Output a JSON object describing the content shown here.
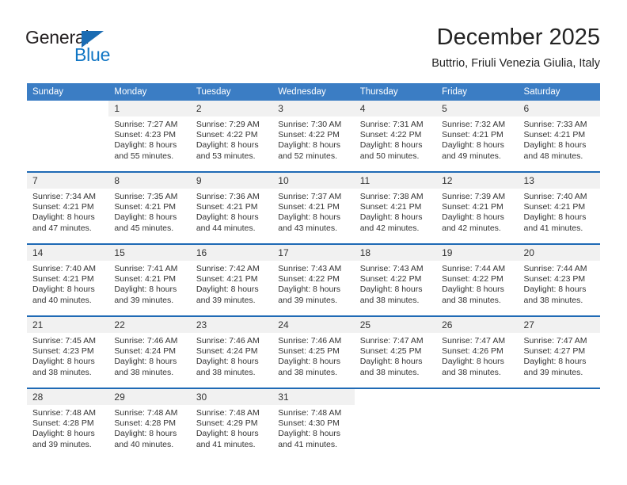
{
  "logo": {
    "word_top": "General",
    "word_bottom": "Blue",
    "triangle_color": "#1b6cb3",
    "blue_color": "#1176c4"
  },
  "header": {
    "title": "December 2025",
    "subtitle": "Buttrio, Friuli Venezia Giulia, Italy"
  },
  "theme": {
    "header_blue": "#3b7dc4",
    "separator_blue": "#1f6ab5",
    "daynum_band": "#f1f1f1",
    "text": "#333333"
  },
  "weekday_headers": [
    "Sunday",
    "Monday",
    "Tuesday",
    "Wednesday",
    "Thursday",
    "Friday",
    "Saturday"
  ],
  "weeks": [
    {
      "days": [
        {
          "num": "",
          "lines": []
        },
        {
          "num": "1",
          "lines": [
            "Sunrise: 7:27 AM",
            "Sunset: 4:23 PM",
            "Daylight: 8 hours",
            "and 55 minutes."
          ]
        },
        {
          "num": "2",
          "lines": [
            "Sunrise: 7:29 AM",
            "Sunset: 4:22 PM",
            "Daylight: 8 hours",
            "and 53 minutes."
          ]
        },
        {
          "num": "3",
          "lines": [
            "Sunrise: 7:30 AM",
            "Sunset: 4:22 PM",
            "Daylight: 8 hours",
            "and 52 minutes."
          ]
        },
        {
          "num": "4",
          "lines": [
            "Sunrise: 7:31 AM",
            "Sunset: 4:22 PM",
            "Daylight: 8 hours",
            "and 50 minutes."
          ]
        },
        {
          "num": "5",
          "lines": [
            "Sunrise: 7:32 AM",
            "Sunset: 4:21 PM",
            "Daylight: 8 hours",
            "and 49 minutes."
          ]
        },
        {
          "num": "6",
          "lines": [
            "Sunrise: 7:33 AM",
            "Sunset: 4:21 PM",
            "Daylight: 8 hours",
            "and 48 minutes."
          ]
        }
      ]
    },
    {
      "days": [
        {
          "num": "7",
          "lines": [
            "Sunrise: 7:34 AM",
            "Sunset: 4:21 PM",
            "Daylight: 8 hours",
            "and 47 minutes."
          ]
        },
        {
          "num": "8",
          "lines": [
            "Sunrise: 7:35 AM",
            "Sunset: 4:21 PM",
            "Daylight: 8 hours",
            "and 45 minutes."
          ]
        },
        {
          "num": "9",
          "lines": [
            "Sunrise: 7:36 AM",
            "Sunset: 4:21 PM",
            "Daylight: 8 hours",
            "and 44 minutes."
          ]
        },
        {
          "num": "10",
          "lines": [
            "Sunrise: 7:37 AM",
            "Sunset: 4:21 PM",
            "Daylight: 8 hours",
            "and 43 minutes."
          ]
        },
        {
          "num": "11",
          "lines": [
            "Sunrise: 7:38 AM",
            "Sunset: 4:21 PM",
            "Daylight: 8 hours",
            "and 42 minutes."
          ]
        },
        {
          "num": "12",
          "lines": [
            "Sunrise: 7:39 AM",
            "Sunset: 4:21 PM",
            "Daylight: 8 hours",
            "and 42 minutes."
          ]
        },
        {
          "num": "13",
          "lines": [
            "Sunrise: 7:40 AM",
            "Sunset: 4:21 PM",
            "Daylight: 8 hours",
            "and 41 minutes."
          ]
        }
      ]
    },
    {
      "days": [
        {
          "num": "14",
          "lines": [
            "Sunrise: 7:40 AM",
            "Sunset: 4:21 PM",
            "Daylight: 8 hours",
            "and 40 minutes."
          ]
        },
        {
          "num": "15",
          "lines": [
            "Sunrise: 7:41 AM",
            "Sunset: 4:21 PM",
            "Daylight: 8 hours",
            "and 39 minutes."
          ]
        },
        {
          "num": "16",
          "lines": [
            "Sunrise: 7:42 AM",
            "Sunset: 4:21 PM",
            "Daylight: 8 hours",
            "and 39 minutes."
          ]
        },
        {
          "num": "17",
          "lines": [
            "Sunrise: 7:43 AM",
            "Sunset: 4:22 PM",
            "Daylight: 8 hours",
            "and 39 minutes."
          ]
        },
        {
          "num": "18",
          "lines": [
            "Sunrise: 7:43 AM",
            "Sunset: 4:22 PM",
            "Daylight: 8 hours",
            "and 38 minutes."
          ]
        },
        {
          "num": "19",
          "lines": [
            "Sunrise: 7:44 AM",
            "Sunset: 4:22 PM",
            "Daylight: 8 hours",
            "and 38 minutes."
          ]
        },
        {
          "num": "20",
          "lines": [
            "Sunrise: 7:44 AM",
            "Sunset: 4:23 PM",
            "Daylight: 8 hours",
            "and 38 minutes."
          ]
        }
      ]
    },
    {
      "days": [
        {
          "num": "21",
          "lines": [
            "Sunrise: 7:45 AM",
            "Sunset: 4:23 PM",
            "Daylight: 8 hours",
            "and 38 minutes."
          ]
        },
        {
          "num": "22",
          "lines": [
            "Sunrise: 7:46 AM",
            "Sunset: 4:24 PM",
            "Daylight: 8 hours",
            "and 38 minutes."
          ]
        },
        {
          "num": "23",
          "lines": [
            "Sunrise: 7:46 AM",
            "Sunset: 4:24 PM",
            "Daylight: 8 hours",
            "and 38 minutes."
          ]
        },
        {
          "num": "24",
          "lines": [
            "Sunrise: 7:46 AM",
            "Sunset: 4:25 PM",
            "Daylight: 8 hours",
            "and 38 minutes."
          ]
        },
        {
          "num": "25",
          "lines": [
            "Sunrise: 7:47 AM",
            "Sunset: 4:25 PM",
            "Daylight: 8 hours",
            "and 38 minutes."
          ]
        },
        {
          "num": "26",
          "lines": [
            "Sunrise: 7:47 AM",
            "Sunset: 4:26 PM",
            "Daylight: 8 hours",
            "and 38 minutes."
          ]
        },
        {
          "num": "27",
          "lines": [
            "Sunrise: 7:47 AM",
            "Sunset: 4:27 PM",
            "Daylight: 8 hours",
            "and 39 minutes."
          ]
        }
      ]
    },
    {
      "days": [
        {
          "num": "28",
          "lines": [
            "Sunrise: 7:48 AM",
            "Sunset: 4:28 PM",
            "Daylight: 8 hours",
            "and 39 minutes."
          ]
        },
        {
          "num": "29",
          "lines": [
            "Sunrise: 7:48 AM",
            "Sunset: 4:28 PM",
            "Daylight: 8 hours",
            "and 40 minutes."
          ]
        },
        {
          "num": "30",
          "lines": [
            "Sunrise: 7:48 AM",
            "Sunset: 4:29 PM",
            "Daylight: 8 hours",
            "and 41 minutes."
          ]
        },
        {
          "num": "31",
          "lines": [
            "Sunrise: 7:48 AM",
            "Sunset: 4:30 PM",
            "Daylight: 8 hours",
            "and 41 minutes."
          ]
        },
        {
          "num": "",
          "lines": []
        },
        {
          "num": "",
          "lines": []
        },
        {
          "num": "",
          "lines": []
        }
      ]
    }
  ]
}
